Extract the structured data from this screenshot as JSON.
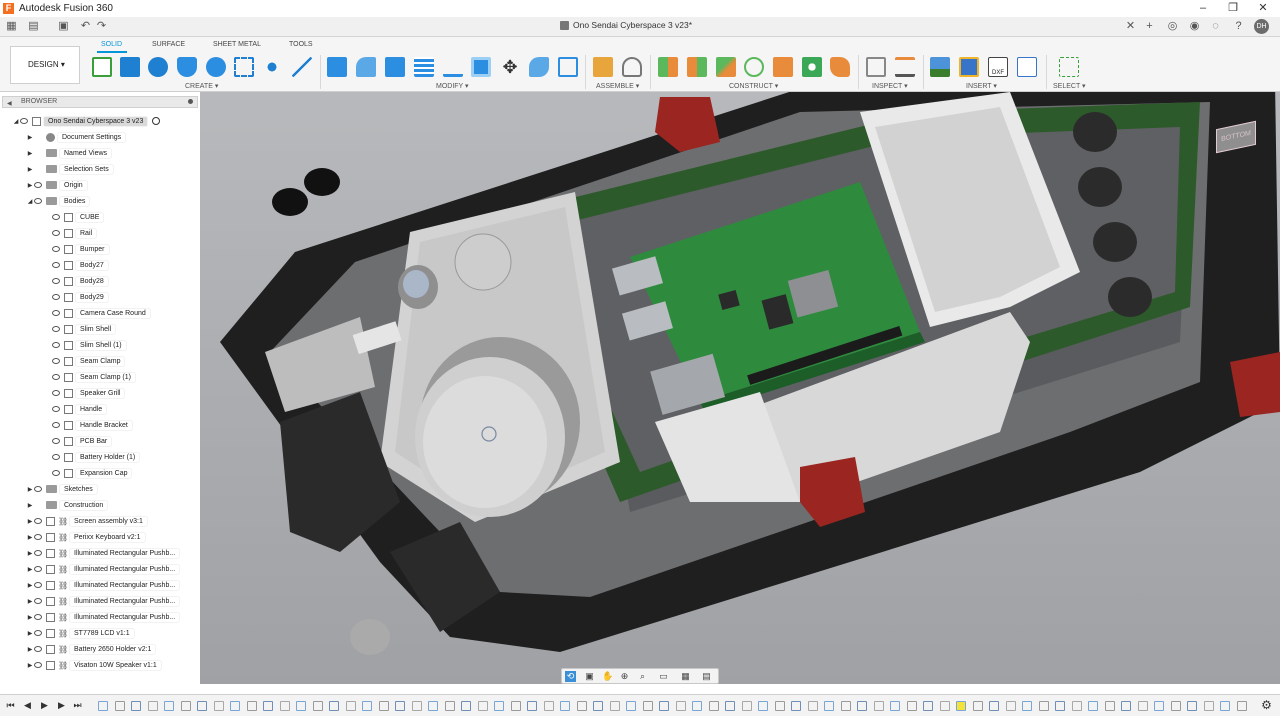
{
  "app": {
    "title": "Autodesk Fusion 360",
    "logo_letter": "F",
    "window_controls": [
      "–",
      "❐",
      "✕"
    ]
  },
  "document": {
    "tab_title": "Ono Sendai Cyberspace 3 v23*",
    "user_initials": "DH"
  },
  "toolbar": {
    "workspace": "DESIGN",
    "tabs": [
      "SOLID",
      "SURFACE",
      "SHEET METAL",
      "TOOLS"
    ],
    "active_tab": "SOLID",
    "groups": [
      "CREATE",
      "MODIFY",
      "ASSEMBLE",
      "CONSTRUCT",
      "INSPECT",
      "INSERT",
      "SELECT"
    ]
  },
  "browser": {
    "title": "BROWSER",
    "root": "Ono Sendai Cyberspace 3 v23",
    "folders": [
      "Document Settings",
      "Named Views",
      "Selection Sets",
      "Origin",
      "Bodies"
    ],
    "bodies": [
      "CUBE",
      "Rail",
      "Bumper",
      "Body27",
      "Body28",
      "Body29",
      "Camera Case Round",
      "Slim Shell",
      "Slim Shell (1)",
      "Seam Clamp",
      "Seam Clamp (1)",
      "Speaker Grill",
      "Handle",
      "Handle Bracket",
      "PCB Bar",
      "Battery Holder (1)",
      "Expansion Cap"
    ],
    "after_bodies": [
      "Sketches",
      "Construction"
    ],
    "components": [
      "Screen assembly v3:1",
      "Perixx Keyboard v2:1",
      "Illuminated Rectangular Pushb...",
      "Illuminated Rectangular Pushb...",
      "Illuminated Rectangular Pushb...",
      "Illuminated Rectangular Pushb...",
      "Illuminated Rectangular Pushb...",
      "ST7789 LCD v1:1",
      "Battery 2650 Holder v2:1",
      "Visaton 10W Speaker v1:1"
    ]
  },
  "viewcube": {
    "label": "BOTTOM"
  },
  "colors": {
    "accent": "#0696d7",
    "canvas_bg": "#a9abaf",
    "enclosure": "#1f1f1f",
    "pcb_green": "#2e8b3e",
    "clamp_red": "#9b2520",
    "tray_green": "#3d6f35",
    "timeline_highlight": "#f4e23a"
  }
}
